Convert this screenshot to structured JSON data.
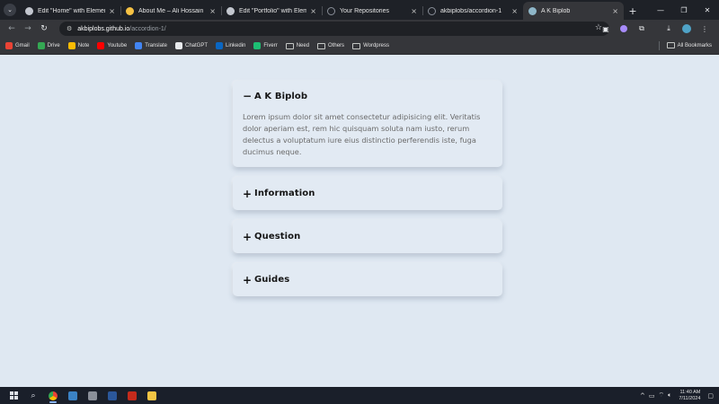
{
  "browser": {
    "tabs": [
      {
        "title": "Edit \"Home\" with Elementor",
        "favicon_color": "#c3c7cf",
        "active": false
      },
      {
        "title": "About Me – Ali Hossain",
        "favicon_color": "#f6c244",
        "active": false
      },
      {
        "title": "Edit \"Portfolio\" with Elementor",
        "favicon_color": "#c3c7cf",
        "active": false
      },
      {
        "title": "Your Repositories",
        "favicon_color": "#1e2127",
        "active": false
      },
      {
        "title": "akbiplobs/accordion-1",
        "favicon_color": "#1e2127",
        "active": false
      },
      {
        "title": "A K Biplob",
        "favicon_color": "#8fb7c9",
        "active": true
      }
    ],
    "close_glyph": "×",
    "new_tab_glyph": "+",
    "url_host": "akbiplobs.github.io",
    "url_path": "/accordion-1/",
    "bookmarks": [
      {
        "label": "Gmail",
        "icon": "gmail-icon",
        "color": "#ea4335"
      },
      {
        "label": "Drive",
        "icon": "drive-icon",
        "color": "#34a853"
      },
      {
        "label": "Note",
        "icon": "note-icon",
        "color": "#fbbc04"
      },
      {
        "label": "Youtube",
        "icon": "youtube-icon",
        "color": "#ff0000"
      },
      {
        "label": "Translate",
        "icon": "translate-icon",
        "color": "#4285f4"
      },
      {
        "label": "ChatGPT",
        "icon": "chatgpt-icon",
        "color": "#e8eaed"
      },
      {
        "label": "Linkedin",
        "icon": "linkedin-icon",
        "color": "#0a66c2"
      },
      {
        "label": "Fiverr",
        "icon": "fiverr-icon",
        "color": "#1dbf73"
      },
      {
        "label": "Need",
        "icon": "folder-icon",
        "color": ""
      },
      {
        "label": "Others",
        "icon": "folder-icon",
        "color": ""
      },
      {
        "label": "Wordpress",
        "icon": "folder-icon",
        "color": ""
      }
    ],
    "all_bookmarks_label": "All Bookmarks"
  },
  "accordion": {
    "items": [
      {
        "title": "A K Biplob",
        "open": true,
        "sign": "−",
        "body": "Lorem ipsum dolor sit amet consectetur adipisicing elit. Veritatis dolor aperiam est, rem hic quisquam soluta nam iusto, rerum delectus a voluptatum iure eius distinctio perferendis iste, fuga ducimus neque."
      },
      {
        "title": "Information",
        "open": false,
        "sign": "+"
      },
      {
        "title": "Question",
        "open": false,
        "sign": "+"
      },
      {
        "title": "Guides",
        "open": false,
        "sign": "+"
      }
    ]
  },
  "taskbar": {
    "time": "11:40 AM",
    "date": "7/11/2024"
  },
  "colors": {
    "page_bg": "#dfe8f2",
    "card_bg": "#e2eaf3",
    "browser_frame": "#1e2127",
    "toolbar": "#35363a",
    "taskbar": "#1a1f2a"
  }
}
